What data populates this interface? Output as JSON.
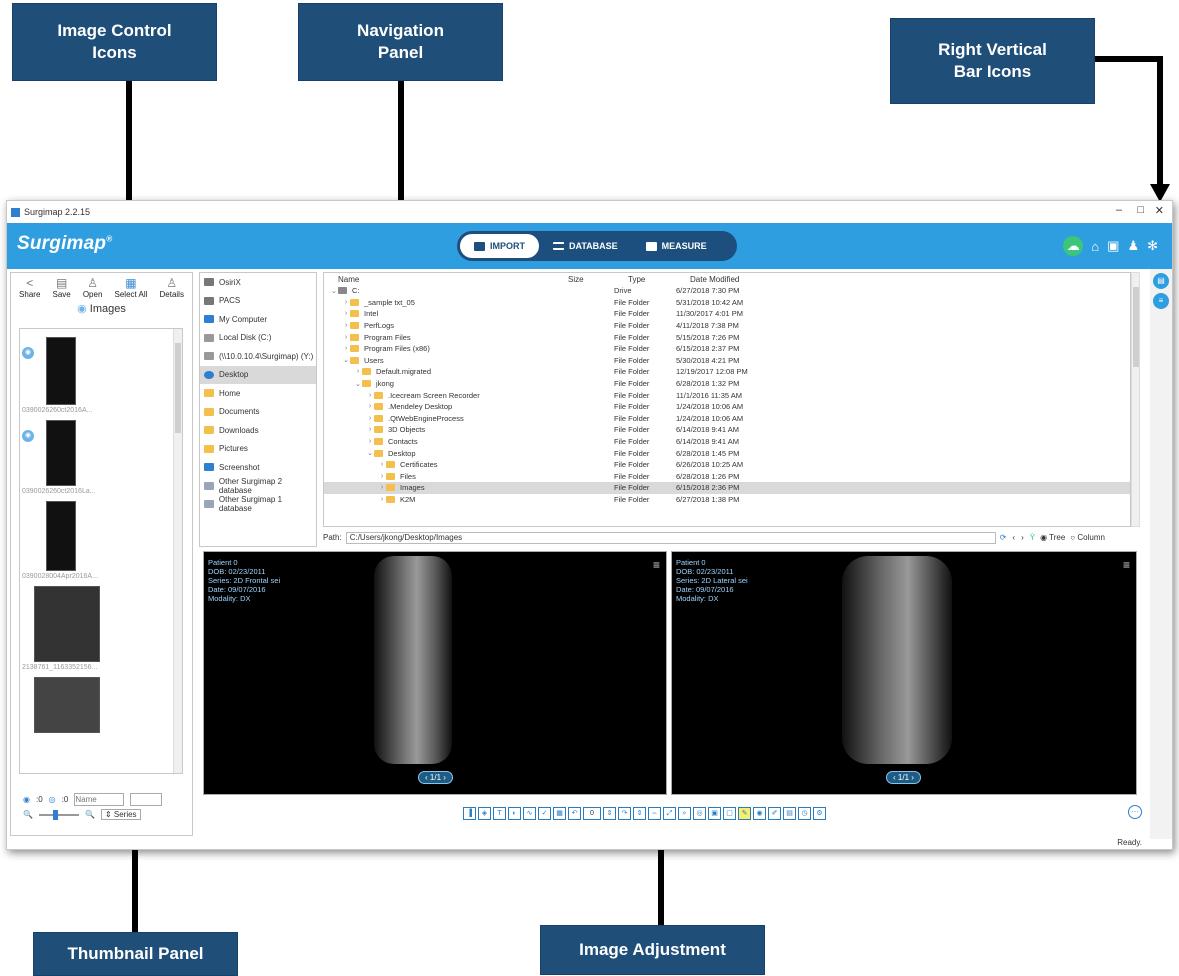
{
  "callouts": {
    "image_control_icons": "Image Control\nIcons",
    "navigation_panel": "Navigation\nPanel",
    "right_vertical_bar_icons": "Right Vertical\nBar Icons",
    "thumbnail_panel": "Thumbnail Panel",
    "image_adjustment": "Image Adjustment"
  },
  "window": {
    "title": "Surgimap 2.2.15",
    "minimize": "–",
    "restore": "□",
    "close": "✕"
  },
  "app": {
    "logo": "Surgimap"
  },
  "tabs": [
    {
      "label": "IMPORT",
      "active": true
    },
    {
      "label": "DATABASE",
      "active": false
    },
    {
      "label": "MEASURE",
      "active": false
    }
  ],
  "top_icons": [
    "cloud-icon",
    "home-icon",
    "camera-icon",
    "bell-icon",
    "gear-icon"
  ],
  "image_controls": [
    {
      "label": "Share",
      "icon": "share-icon"
    },
    {
      "label": "Save",
      "icon": "save-icon"
    },
    {
      "label": "Open",
      "icon": "open-icon"
    },
    {
      "label": "Select All",
      "icon": "select-all-icon"
    },
    {
      "label": "Details",
      "icon": "details-icon"
    }
  ],
  "thumbnail_panel": {
    "title": "Images",
    "thumbnails": [
      {
        "caption": "0390026260ct2016A..."
      },
      {
        "caption": "0390026260ct2016La..."
      },
      {
        "caption": "0390028004Apr2016A..."
      },
      {
        "caption": "2138761_1163352156..."
      },
      {
        "caption": ""
      }
    ],
    "counter_a": "0",
    "counter_b": "0",
    "name_placeholder": "Name",
    "series_label": "Series"
  },
  "nav_panel": {
    "items": [
      {
        "label": "OsiriX",
        "color": "#777777"
      },
      {
        "label": "PACS",
        "color": "#777777"
      },
      {
        "label": "My Computer",
        "color": "#2f7fd0"
      },
      {
        "label": "Local Disk (C:)",
        "color": "#999999"
      },
      {
        "label": "(\\\\10.0.10.4\\Surgimap) (Y:)",
        "color": "#999999"
      },
      {
        "label": "Desktop",
        "color": "#2f7fd0",
        "selected": true
      },
      {
        "label": "Home",
        "color": "#f3c14b"
      },
      {
        "label": "Documents",
        "color": "#f3c14b"
      },
      {
        "label": "Downloads",
        "color": "#f3c14b"
      },
      {
        "label": "Pictures",
        "color": "#f3c14b"
      },
      {
        "label": "Screenshot",
        "color": "#2f7fd0"
      },
      {
        "label": "Other Surgimap 2 database",
        "color": "#9aa6b8"
      },
      {
        "label": "Other Surgimap 1 database",
        "color": "#9aa6b8"
      }
    ]
  },
  "file_list": {
    "columns": [
      "Name",
      "Size",
      "Type",
      "Date Modified"
    ],
    "rows": [
      {
        "name": "C:",
        "type": "Drive",
        "date": "6/27/2018 7:30 PM",
        "level": 0,
        "chev": "v"
      },
      {
        "name": "_sample txt_05",
        "type": "File Folder",
        "date": "5/31/2018 10:42 AM",
        "level": 1,
        "chev": ">"
      },
      {
        "name": "Intel",
        "type": "File Folder",
        "date": "11/30/2017 4:01 PM",
        "level": 1,
        "chev": ">"
      },
      {
        "name": "PerfLogs",
        "type": "File Folder",
        "date": "4/11/2018 7:38 PM",
        "level": 1,
        "chev": ">"
      },
      {
        "name": "Program Files",
        "type": "File Folder",
        "date": "5/15/2018 7:26 PM",
        "level": 1,
        "chev": ">"
      },
      {
        "name": "Program Files (x86)",
        "type": "File Folder",
        "date": "6/15/2018 2:37 PM",
        "level": 1,
        "chev": ">"
      },
      {
        "name": "Users",
        "type": "File Folder",
        "date": "5/30/2018 4:21 PM",
        "level": 1,
        "chev": "v"
      },
      {
        "name": "Default.migrated",
        "type": "File Folder",
        "date": "12/19/2017 12:08 PM",
        "level": 2,
        "chev": ">"
      },
      {
        "name": "jkong",
        "type": "File Folder",
        "date": "6/28/2018 1:32 PM",
        "level": 2,
        "chev": "v"
      },
      {
        "name": ".Icecream Screen Recorder",
        "type": "File Folder",
        "date": "11/1/2016 11:35 AM",
        "level": 3,
        "chev": ">"
      },
      {
        "name": ".Mendeley Desktop",
        "type": "File Folder",
        "date": "1/24/2018 10:06 AM",
        "level": 3,
        "chev": ">"
      },
      {
        "name": ".QtWebEngineProcess",
        "type": "File Folder",
        "date": "1/24/2018 10:06 AM",
        "level": 3,
        "chev": ">"
      },
      {
        "name": "3D Objects",
        "type": "File Folder",
        "date": "6/14/2018 9:41 AM",
        "level": 3,
        "chev": ">"
      },
      {
        "name": "Contacts",
        "type": "File Folder",
        "date": "6/14/2018 9:41 AM",
        "level": 3,
        "chev": ">"
      },
      {
        "name": "Desktop",
        "type": "File Folder",
        "date": "6/28/2018 1:45 PM",
        "level": 3,
        "chev": "v"
      },
      {
        "name": "Certificates",
        "type": "File Folder",
        "date": "6/26/2018 10:25 AM",
        "level": 4,
        "chev": ">"
      },
      {
        "name": "Files",
        "type": "File Folder",
        "date": "6/28/2018 1:26 PM",
        "level": 4,
        "chev": ">"
      },
      {
        "name": "Images",
        "type": "File Folder",
        "date": "6/15/2018 2:36 PM",
        "level": 4,
        "chev": ">",
        "selected": true
      },
      {
        "name": "K2M",
        "type": "File Folder",
        "date": "6/27/2018 1:38 PM",
        "level": 4,
        "chev": ">"
      }
    ]
  },
  "path_bar": {
    "label": "Path:",
    "value": "C:/Users/jkong/Desktop/Images",
    "tree_label": "Tree",
    "column_label": "Column"
  },
  "viewers": [
    {
      "patient": "Patient 0",
      "dob": "DOB: 02/23/2011",
      "series": "Series: 2D Frontal sei",
      "date": "Date: 09/07/2016",
      "modality": "Modality: DX",
      "pager": "1/1"
    },
    {
      "patient": "Patient 0",
      "dob": "DOB: 02/23/2011",
      "series": "Series: 2D Lateral sei",
      "date": "Date: 09/07/2016",
      "modality": "Modality: DX",
      "pager": "1/1"
    }
  ],
  "adjust_value": "0",
  "status": "Ready."
}
